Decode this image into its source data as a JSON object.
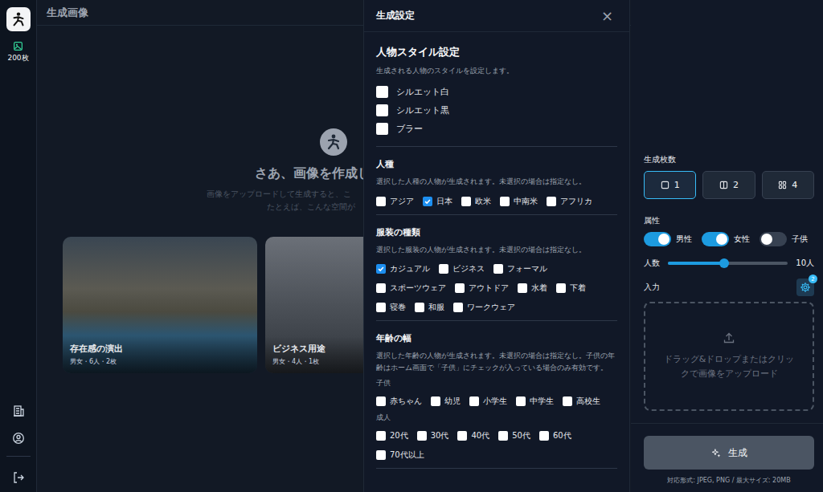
{
  "sidebar": {
    "credits": "200枚"
  },
  "main": {
    "title": "生成画像",
    "hero_title": "さあ、画像を作成し",
    "hero_lines": [
      "画像をアップロードして生成すると、こ",
      "たとえば、こんな空間が"
    ],
    "cards": [
      {
        "title": "存在感の演出",
        "meta": "男女・6人・2枚"
      },
      {
        "title": "ビジネス用途",
        "meta": "男女・4人・1枚"
      }
    ]
  },
  "settings_panel": {
    "title": "生成設定",
    "close": "×",
    "style_section": {
      "title": "人物スタイル設定",
      "description": "生成される人物のスタイルを設定します。",
      "options": [
        {
          "label": "シルエット白",
          "checked": false
        },
        {
          "label": "シルエット黒",
          "checked": false
        },
        {
          "label": "ブラー",
          "checked": false
        }
      ]
    },
    "sections": [
      {
        "title": "人種",
        "description": "選択した人種の人物が生成されます。未選択の場合は指定なし。",
        "options": [
          {
            "label": "アジア",
            "checked": false
          },
          {
            "label": "日本",
            "checked": true
          },
          {
            "label": "欧米",
            "checked": false
          },
          {
            "label": "中南米",
            "checked": false
          },
          {
            "label": "アフリカ",
            "checked": false
          }
        ]
      },
      {
        "title": "服装の種類",
        "description": "選択した服装の人物が生成されます。未選択の場合は指定なし。",
        "options": [
          {
            "label": "カジュアル",
            "checked": true
          },
          {
            "label": "ビジネス",
            "checked": false
          },
          {
            "label": "フォーマル",
            "checked": false
          },
          {
            "label": "スポーツウェア",
            "checked": false
          },
          {
            "label": "アウトドア",
            "checked": false
          },
          {
            "label": "水着",
            "checked": false
          },
          {
            "label": "下着",
            "checked": false
          },
          {
            "label": "寝巻",
            "checked": false
          },
          {
            "label": "和服",
            "checked": false
          },
          {
            "label": "ワークウェア",
            "checked": false
          }
        ]
      },
      {
        "title": "年齢の幅",
        "description": "選択した年齢の人物が生成されます。未選択の場合は指定なし。子供の年齢はホーム画面で「子供」にチェックが入っている場合のみ有効です。",
        "groups": [
          {
            "label": "子供",
            "options": [
              {
                "label": "赤ちゃん",
                "checked": false
              },
              {
                "label": "幼児",
                "checked": false
              },
              {
                "label": "小学生",
                "checked": false
              },
              {
                "label": "中学生",
                "checked": false
              },
              {
                "label": "高校生",
                "checked": false
              }
            ]
          },
          {
            "label": "成人",
            "options": [
              {
                "label": "20代",
                "checked": false
              },
              {
                "label": "30代",
                "checked": false
              },
              {
                "label": "40代",
                "checked": false
              },
              {
                "label": "50代",
                "checked": false
              },
              {
                "label": "60代",
                "checked": false
              },
              {
                "label": "70代以上",
                "checked": false
              }
            ]
          }
        ]
      }
    ]
  },
  "right_panel": {
    "count": {
      "label": "生成枚数",
      "options": [
        {
          "label": "1",
          "selected": true
        },
        {
          "label": "2",
          "selected": false
        },
        {
          "label": "4",
          "selected": false
        }
      ]
    },
    "attributes": {
      "label": "属性",
      "toggles": [
        {
          "label": "男性",
          "on": true
        },
        {
          "label": "女性",
          "on": true
        },
        {
          "label": "子供",
          "on": false
        }
      ]
    },
    "people": {
      "label": "人数",
      "level": 0.47,
      "reading": "10人"
    },
    "input": {
      "label": "入力",
      "badge": "2",
      "dropzone": "ドラッグ&ドロップまたはクリックで画像をアップロード"
    },
    "generate": {
      "label": "生成"
    },
    "footer": "対応形式: JPEG, PNG / 最大サイズ: 20MB"
  }
}
